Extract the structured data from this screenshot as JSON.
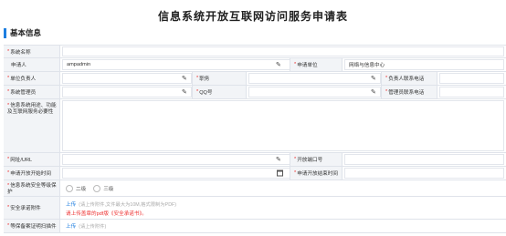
{
  "page": {
    "title": "信息系统开放互联网访问服务申请表"
  },
  "section": {
    "title": "基本信息"
  },
  "fields": {
    "system_name": {
      "label": "系统名称",
      "required": "*",
      "value": ""
    },
    "applicant": {
      "label": "申请人",
      "value": "ampadmin"
    },
    "applicant_unit": {
      "label": "申请单位",
      "required": "*",
      "value": "网络与信息中心"
    },
    "unit_head": {
      "label": "单位负责人",
      "required": "*",
      "value": ""
    },
    "position": {
      "label": "职务",
      "required": "*",
      "value": ""
    },
    "head_phone": {
      "label": "负责人联系电话",
      "required": "*",
      "value": ""
    },
    "system_admin": {
      "label": "系统管理员",
      "required": "*",
      "value": ""
    },
    "qq": {
      "label": "QQ号",
      "required": "*",
      "value": ""
    },
    "admin_phone": {
      "label": "管理员联系电话",
      "required": "*",
      "value": ""
    },
    "purpose": {
      "label": "信息系统用途、功能及互联网服务必要性",
      "required": "*",
      "value": ""
    },
    "url": {
      "label": "网址/URL",
      "required": "*",
      "value": ""
    },
    "port": {
      "label": "开放端口号",
      "required": "*",
      "value": ""
    },
    "start_time": {
      "label": "申请开放开始时间",
      "required": "*",
      "value": ""
    },
    "end_time": {
      "label": "申请开放结束时间",
      "required": "*",
      "value": ""
    },
    "security_level": {
      "label": "信息系统安全等级保护",
      "required": "*",
      "options": [
        "二级",
        "三级"
      ]
    },
    "security_attachment": {
      "label": "安全承诺附件",
      "required": "*",
      "upload": "上传",
      "hint": "(请上传附件,文件最大为10M,格式限制为PDF)",
      "warning": "请上传盖章的pdf版《安全承诺书》。"
    },
    "filing_scan": {
      "label": "等保备案证明扫描件",
      "required": "*",
      "upload": "上传",
      "hint": "(请上传附件)"
    }
  },
  "icons": {
    "edit": "pencil-icon",
    "date": "calendar-icon"
  },
  "colors": {
    "accent": "#1e7ee0",
    "required": "#e33333",
    "label_bg": "#f2f4f7"
  }
}
